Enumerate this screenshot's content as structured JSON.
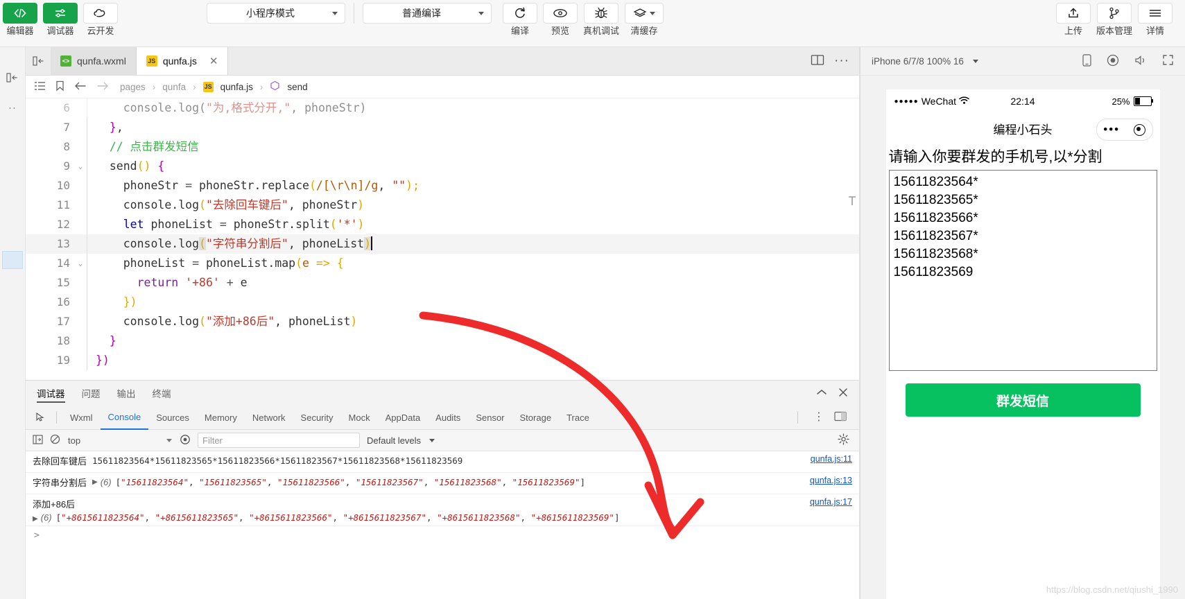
{
  "toolbar": {
    "left_buttons": [
      {
        "label": "编辑器",
        "icon": "code-icon",
        "active": true
      },
      {
        "label": "调试器",
        "icon": "sliders-icon",
        "active": true
      },
      {
        "label": "云开发",
        "icon": "cloud-icon",
        "active": false
      }
    ],
    "mode_select": "小程序模式",
    "compile_select": "普通编译",
    "action_buttons": [
      {
        "label": "编译",
        "icon": "refresh-icon"
      },
      {
        "label": "预览",
        "icon": "eye-icon"
      },
      {
        "label": "真机调试",
        "icon": "bug-icon"
      },
      {
        "label": "清缓存",
        "icon": "layers-icon"
      }
    ],
    "right_buttons": [
      {
        "label": "上传",
        "icon": "upload-icon"
      },
      {
        "label": "版本管理",
        "icon": "branch-icon"
      },
      {
        "label": "详情",
        "icon": "menu-icon"
      }
    ]
  },
  "tabs": [
    {
      "label": "qunfa.wxml",
      "type": "wxml",
      "badge": "W",
      "active": false,
      "closable": false
    },
    {
      "label": "qunfa.js",
      "type": "js",
      "badge": "JS",
      "active": true,
      "closable": true,
      "close": "✕"
    }
  ],
  "tab_right_icons": [
    "split-editor-icon",
    "more-icon"
  ],
  "breadcrumb": {
    "icons": [
      "outline-icon",
      "bookmark-icon",
      "back-arrow-icon",
      "forward-arrow-icon"
    ],
    "parts": [
      "pages",
      "qunfa",
      "qunfa.js",
      "send"
    ],
    "separator": "›",
    "file_badge": "JS",
    "symbol_icon": "symbol-method-icon"
  },
  "code": {
    "lines": [
      {
        "n": 6,
        "fold": "",
        "partial": true,
        "tokens": [
          {
            "t": "    console.log(",
            "c": "plain"
          },
          {
            "t": "\"为,格式分开,\"",
            "c": "str"
          },
          {
            "t": ", phoneStr)",
            "c": "plain"
          }
        ]
      },
      {
        "n": 7,
        "fold": "",
        "tokens": [
          {
            "t": "  }",
            "c": "par2"
          },
          {
            "t": ",",
            "c": "plain"
          }
        ]
      },
      {
        "n": 8,
        "fold": "",
        "tokens": [
          {
            "t": "  // 点击群发短信",
            "c": "cmt"
          }
        ]
      },
      {
        "n": 9,
        "fold": "⌄",
        "tokens": [
          {
            "t": "  send",
            "c": "plain"
          },
          {
            "t": "()",
            "c": "par"
          },
          {
            "t": " ",
            "c": "plain"
          },
          {
            "t": "{",
            "c": "par2"
          }
        ]
      },
      {
        "n": 10,
        "fold": "",
        "tokens": [
          {
            "t": "    phoneStr ",
            "c": "plain"
          },
          {
            "t": "=",
            "c": "op"
          },
          {
            "t": " phoneStr.replace",
            "c": "plain"
          },
          {
            "t": "(",
            "c": "par"
          },
          {
            "t": "/[\\r\\n]/g",
            "c": "num"
          },
          {
            "t": ", ",
            "c": "plain"
          },
          {
            "t": "\"\"",
            "c": "str"
          },
          {
            "t": ")",
            "c": "par"
          },
          {
            "t": ";",
            "c": "par"
          }
        ]
      },
      {
        "n": 11,
        "fold": "",
        "tokens": [
          {
            "t": "    console.log",
            "c": "plain"
          },
          {
            "t": "(",
            "c": "par"
          },
          {
            "t": "\"去除回车键后\"",
            "c": "str"
          },
          {
            "t": ", phoneStr",
            "c": "plain"
          },
          {
            "t": ")",
            "c": "par"
          }
        ]
      },
      {
        "n": 12,
        "fold": "",
        "tokens": [
          {
            "t": "    let",
            "c": "kw"
          },
          {
            "t": " phoneList ",
            "c": "plain"
          },
          {
            "t": "=",
            "c": "op"
          },
          {
            "t": " phoneStr.split",
            "c": "plain"
          },
          {
            "t": "(",
            "c": "par"
          },
          {
            "t": "'*'",
            "c": "str"
          },
          {
            "t": ")",
            "c": "par"
          }
        ]
      },
      {
        "n": 13,
        "fold": "",
        "highlight": true,
        "cursor": true,
        "tokens": [
          {
            "t": "    console.log",
            "c": "plain"
          },
          {
            "t": "(",
            "c": "par selhl"
          },
          {
            "t": "\"字符串分割后\"",
            "c": "str"
          },
          {
            "t": ", phoneList",
            "c": "plain"
          },
          {
            "t": ")",
            "c": "par selhl"
          }
        ]
      },
      {
        "n": 14,
        "fold": "⌄",
        "tokens": [
          {
            "t": "    phoneList ",
            "c": "plain"
          },
          {
            "t": "=",
            "c": "op"
          },
          {
            "t": " phoneList.map",
            "c": "plain"
          },
          {
            "t": "(",
            "c": "par"
          },
          {
            "t": "e",
            "c": "num"
          },
          {
            "t": " ",
            "c": "plain"
          },
          {
            "t": "=>",
            "c": "par"
          },
          {
            "t": " ",
            "c": "plain"
          },
          {
            "t": "{",
            "c": "par"
          }
        ]
      },
      {
        "n": 15,
        "fold": "",
        "tokens": [
          {
            "t": "      return",
            "c": "kw2"
          },
          {
            "t": " ",
            "c": "plain"
          },
          {
            "t": "'+86'",
            "c": "str"
          },
          {
            "t": " ",
            "c": "plain"
          },
          {
            "t": "+",
            "c": "op"
          },
          {
            "t": " e",
            "c": "plain"
          }
        ]
      },
      {
        "n": 16,
        "fold": "",
        "tokens": [
          {
            "t": "    })",
            "c": "par"
          }
        ]
      },
      {
        "n": 17,
        "fold": "",
        "tokens": [
          {
            "t": "    console.log",
            "c": "plain"
          },
          {
            "t": "(",
            "c": "par"
          },
          {
            "t": "\"添加+86后\"",
            "c": "str"
          },
          {
            "t": ", phoneList",
            "c": "plain"
          },
          {
            "t": ")",
            "c": "par"
          }
        ]
      },
      {
        "n": 18,
        "fold": "",
        "tokens": [
          {
            "t": "  }",
            "c": "par2"
          }
        ]
      },
      {
        "n": 19,
        "fold": "",
        "tokens": [
          {
            "t": "})",
            "c": "par2"
          }
        ]
      }
    ]
  },
  "devtools": {
    "top_tabs": [
      {
        "label": "调试器",
        "active": true
      },
      {
        "label": "问题",
        "active": false
      },
      {
        "label": "输出",
        "active": false
      },
      {
        "label": "终端",
        "active": false
      }
    ],
    "top_right_icons": [
      "collapse-icon",
      "close-icon"
    ],
    "panel_tabs": [
      {
        "label": "Wxml",
        "active": false
      },
      {
        "label": "Console",
        "active": true
      },
      {
        "label": "Sources",
        "active": false
      },
      {
        "label": "Memory",
        "active": false
      },
      {
        "label": "Network",
        "active": false
      },
      {
        "label": "Security",
        "active": false
      },
      {
        "label": "Mock",
        "active": false
      },
      {
        "label": "AppData",
        "active": false
      },
      {
        "label": "Audits",
        "active": false
      },
      {
        "label": "Sensor",
        "active": false
      },
      {
        "label": "Storage",
        "active": false
      },
      {
        "label": "Trace",
        "active": false
      }
    ],
    "panel_right_icons": [
      "more-vertical-icon",
      "dock-icon",
      "settings-icon"
    ],
    "filter_bar": {
      "context": "top",
      "filter_placeholder": "Filter",
      "levels": "Default levels",
      "icons": [
        "sidebar-icon",
        "clear-console-icon",
        "eye-icon"
      ]
    },
    "logs": [
      {
        "label": "去除回车键后",
        "value": "15611823564*15611823565*15611823566*15611823567*15611823568*15611823569",
        "source": "qunfa.js:11",
        "expandable": false,
        "wrapped": false
      },
      {
        "label": "字符串分割后",
        "count": "(6)",
        "array": [
          "\"15611823564\"",
          "\"15611823565\"",
          "\"15611823566\"",
          "\"15611823567\"",
          "\"15611823568\"",
          "\"15611823569\""
        ],
        "source": "qunfa.js:13",
        "expandable": true,
        "wrapped": false
      },
      {
        "label": "添加+86后",
        "count": "(6)",
        "array": [
          "\"+8615611823564\"",
          "\"+8615611823565\"",
          "\"+8615611823566\"",
          "\"+8615611823567\"",
          "\"+8615611823568\"",
          "\"+8615611823569\""
        ],
        "source": "qunfa.js:17",
        "expandable": true,
        "wrapped": true
      }
    ],
    "prompt": ">"
  },
  "simulator": {
    "device": "iPhone 6/7/8 100% 16",
    "header_icons": [
      "phone-icon",
      "record-icon",
      "volume-icon",
      "fullscreen-icon"
    ],
    "status": {
      "carrier": "WeChat",
      "signal_dots": "●●●●●",
      "time": "22:14",
      "battery_pct": "25%"
    },
    "nav_title": "编程小石头",
    "capsule": {
      "dots": "•••",
      "target": "target-icon"
    },
    "page": {
      "hint": "请输入你要群发的手机号,以*分割",
      "textarea_value": "15611823564*\n15611823565*\n15611823566*\n15611823567*\n15611823568*\n15611823569",
      "button_label": "群发短信"
    }
  },
  "watermark": "https://blog.csdn.net/qiushi_1990",
  "colors": {
    "wechat_green": "#07c160",
    "toolbar_green": "#16a34a",
    "devtools_blue": "#1a73e8",
    "arrow_red": "#ee2b2b",
    "string_red": "#c41a16",
    "comment_green": "#3cb54a"
  }
}
